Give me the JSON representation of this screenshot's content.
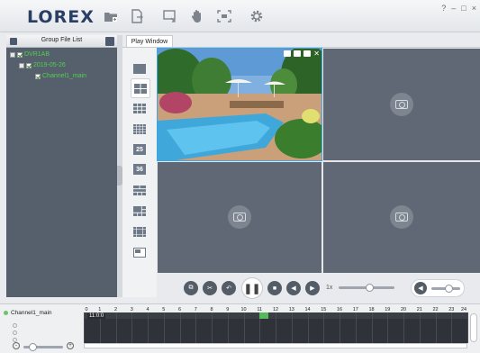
{
  "app": {
    "logo": "LOREX"
  },
  "window_controls": {
    "help": "?",
    "minimize": "–",
    "maximize": "□",
    "close": "×"
  },
  "toolbar": {
    "icons": [
      "folder-add-icon",
      "file-export-icon",
      "window-export-icon",
      "hand-icon",
      "fit-screen-icon",
      "gear-icon"
    ]
  },
  "left_panel": {
    "title": "Group File List",
    "tree": [
      {
        "label": "DVR1AB",
        "level": 0
      },
      {
        "label": "2019-05-26",
        "level": 1
      },
      {
        "label": "Channel1_main",
        "level": 2
      }
    ]
  },
  "tabs": [
    {
      "label": "Play Window"
    }
  ],
  "layouts": [
    {
      "id": "1",
      "label": ""
    },
    {
      "id": "4",
      "label": "",
      "active": true
    },
    {
      "id": "9",
      "label": ""
    },
    {
      "id": "16",
      "label": ""
    },
    {
      "id": "25",
      "label": "25"
    },
    {
      "id": "36",
      "label": "36"
    },
    {
      "id": "8",
      "label": ""
    },
    {
      "id": "6",
      "label": ""
    },
    {
      "id": "13",
      "label": ""
    },
    {
      "id": "pip",
      "label": ""
    }
  ],
  "playback": {
    "speed": "1x",
    "buttons": [
      "snapshot",
      "clip",
      "rewind",
      "pause",
      "stop",
      "frame-back",
      "frame-forward"
    ],
    "progress": 0.55,
    "volume": 0.6
  },
  "timeline": {
    "channel": "Channel1_main",
    "hours": [
      "0",
      "1",
      "2",
      "3",
      "4",
      "5",
      "6",
      "7",
      "8",
      "9",
      "10",
      "11",
      "12",
      "13",
      "14",
      "15",
      "16",
      "17",
      "18",
      "19",
      "20",
      "21",
      "22",
      "23",
      "24"
    ],
    "current_time": "11:0:0",
    "recording_hour": 11
  },
  "colors": {
    "accent": "#3ea6e6",
    "recording": "#56b95b",
    "tree_text": "#50d050"
  }
}
